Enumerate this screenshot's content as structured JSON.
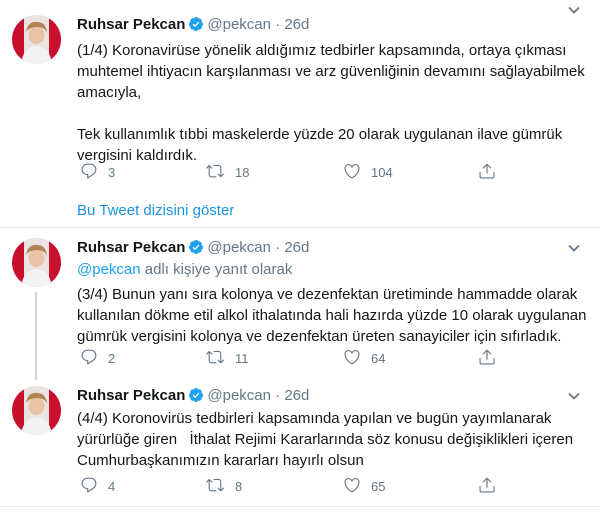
{
  "colors": {
    "accent": "#1da1f2",
    "link": "#1b95e0",
    "muted": "#657786",
    "text": "#14171a",
    "divider": "#e6ecf0"
  },
  "tweets": [
    {
      "name": "Ruhsar Pekcan",
      "handle": "@pekcan",
      "dot": "·",
      "date": "26d",
      "body": "(1/4) Koronavirüse yönelik aldığımız tedbirler kapsamında, ortaya çıkması muhtemel ihtiyacın karşılanması ve arz güvenliğinin devamını sağlayabilmek amacıyla,\n\nTek kullanımlık tıbbi maskelerde yüzde 20 olarak uygulanan ilave gümrük vergisini kaldırdık.",
      "replies": "3",
      "retweets": "18",
      "likes": "104"
    },
    {
      "name": "Ruhsar Pekcan",
      "handle": "@pekcan",
      "dot": "·",
      "date": "26d",
      "reply_mention": "@pekcan",
      "reply_suffix": " adlı kişiye yanıt olarak",
      "body": "(3/4) Bunun yanı sıra kolonya ve dezenfektan üretiminde hammadde olarak kullanılan dökme etil alkol ithalatında hali hazırda yüzde 10 olarak uygulanan gümrük vergisini kolonya ve dezenfektan üreten sanayiciler için sıfırladık.",
      "replies": "2",
      "retweets": "11",
      "likes": "64"
    },
    {
      "name": "Ruhsar Pekcan",
      "handle": "@pekcan",
      "dot": "·",
      "date": "26d",
      "body": "(4/4) Koronovirüs tedbirleri kapsamında yapılan ve bugün yayımlanarak yürürlüğe giren   İthalat Rejimi Kararlarında söz konusu değişiklikleri içeren Cumhurbaşkanımızın kararları hayırlı olsun",
      "replies": "4",
      "retweets": "8",
      "likes": "65"
    }
  ],
  "show_thread": "Bu Tweet dizisini göster"
}
